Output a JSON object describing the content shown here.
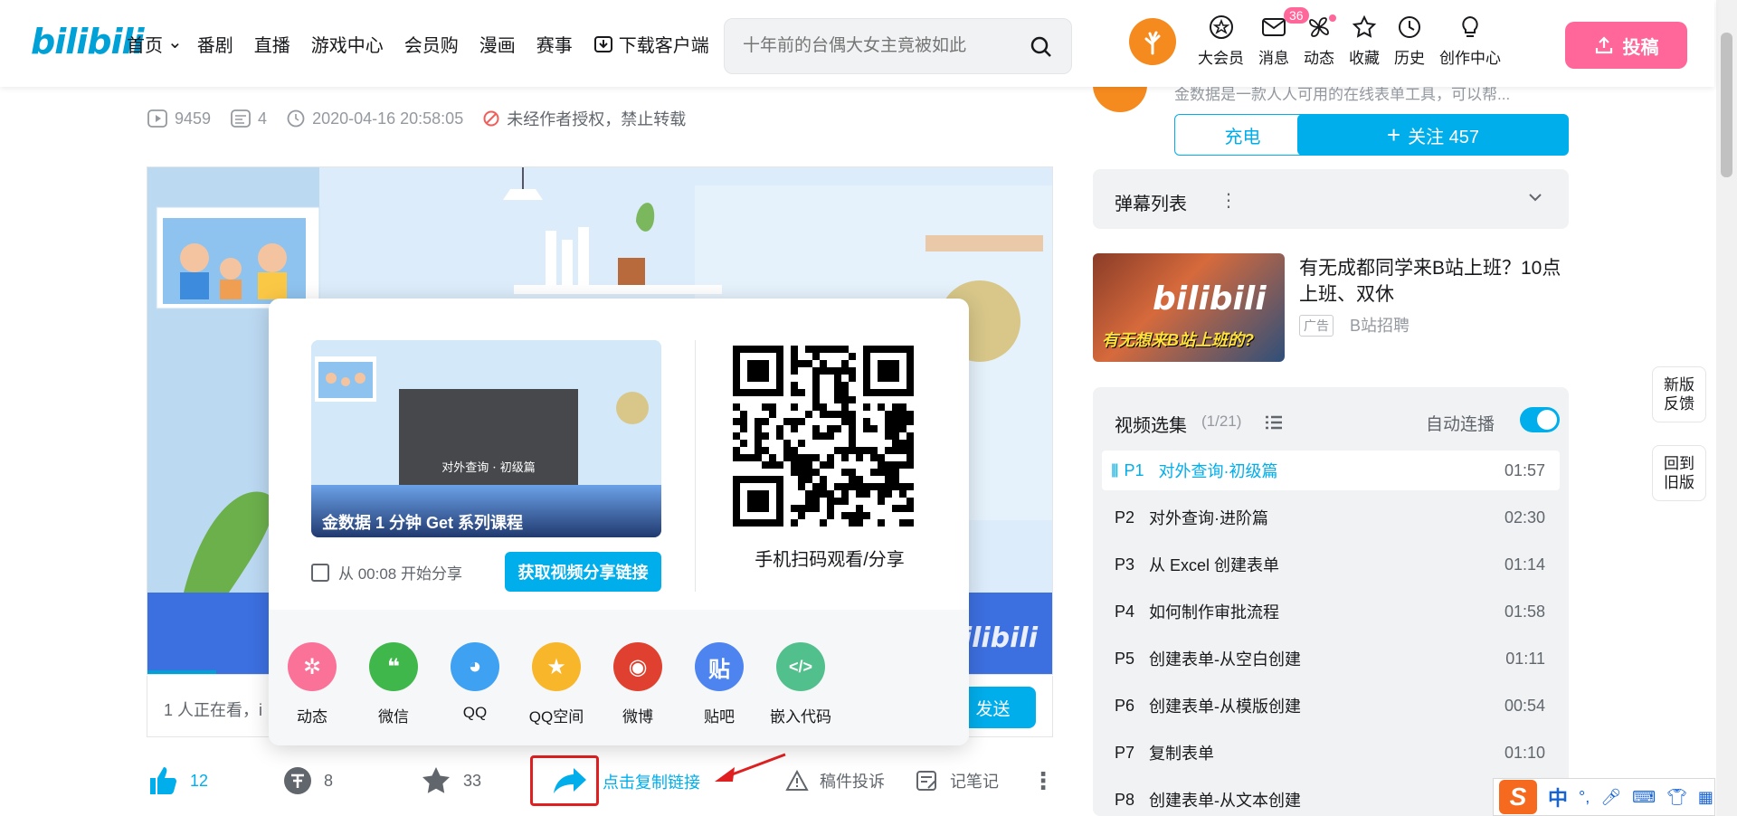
{
  "header": {
    "logo": "bilibili",
    "nav": [
      "首页",
      "番剧",
      "直播",
      "游戏中心",
      "会员购",
      "漫画",
      "赛事"
    ],
    "download": "下载客户端",
    "search_placeholder": "十年前的台偶大女主竟被如此",
    "icons": [
      {
        "label": "大会员",
        "icon": "vip-icon"
      },
      {
        "label": "消息",
        "icon": "message-icon",
        "badge": "36"
      },
      {
        "label": "动态",
        "icon": "dynamic-icon"
      },
      {
        "label": "收藏",
        "icon": "favorite-icon"
      },
      {
        "label": "历史",
        "icon": "history-icon"
      },
      {
        "label": "创作中心",
        "icon": "creator-icon"
      }
    ],
    "upload": "投稿"
  },
  "video_meta": {
    "views": "9459",
    "danmaku": "4",
    "date": "2020-04-16 20:58:05",
    "copyright": "未经作者授权，禁止转载"
  },
  "danmu_bar": {
    "watching": "1 人正在看，i",
    "send": "发送"
  },
  "actions": {
    "likes": "12",
    "coins": "8",
    "favorites": "33",
    "copy_link": "点击复制链接",
    "report": "稿件投诉",
    "notes": "记笔记"
  },
  "share_popup": {
    "video_caption": "金数据 1 分钟 Get 系列课程",
    "video_inner_title": "对外查询 · 初级篇",
    "start_share": "从 00:08 开始分享",
    "get_link": "获取视频分享链接",
    "qr_label": "手机扫码观看/分享",
    "targets": [
      {
        "label": "动态",
        "color": "#fb7299",
        "glyph": "✲"
      },
      {
        "label": "微信",
        "color": "#3fb74b",
        "glyph": "❝"
      },
      {
        "label": "QQ",
        "color": "#3ea1f2",
        "glyph": "◕"
      },
      {
        "label": "QQ空间",
        "color": "#f8b62b",
        "glyph": "★"
      },
      {
        "label": "微博",
        "color": "#e0402f",
        "glyph": "◉"
      },
      {
        "label": "贴吧",
        "color": "#4d84f0",
        "glyph": "贴"
      },
      {
        "label": "嵌入代码",
        "color": "#52c08c",
        "glyph": "</>"
      }
    ]
  },
  "uploader": {
    "desc": "金数据是一款人人可用的在线表单工具，可以帮...",
    "charge": "充电",
    "follow": "关注 457"
  },
  "danmaku_list": {
    "title": "弹幕列表"
  },
  "ad": {
    "title": "有无成都同学来B站上班？10点上班、双休",
    "tag": "广告",
    "source": "B站招聘",
    "image_logo": "bilibili",
    "image_slogan": "有无想来B站上班的?"
  },
  "playlist": {
    "title": "视频选集",
    "count": "(1/21)",
    "autoplay": "自动连播",
    "episodes": [
      {
        "p": "P1",
        "title": "对外查询·初级篇",
        "dur": "01:57",
        "active": true
      },
      {
        "p": "P2",
        "title": "对外查询·进阶篇",
        "dur": "02:30"
      },
      {
        "p": "P3",
        "title": "从 Excel 创建表单",
        "dur": "01:14"
      },
      {
        "p": "P4",
        "title": "如何制作审批流程",
        "dur": "01:58"
      },
      {
        "p": "P5",
        "title": "创建表单-从空白创建",
        "dur": "01:11"
      },
      {
        "p": "P6",
        "title": "创建表单-从模版创建",
        "dur": "00:54"
      },
      {
        "p": "P7",
        "title": "复制表单",
        "dur": "01:10"
      },
      {
        "p": "P8",
        "title": "创建表单-从文本创建",
        "dur": ""
      }
    ]
  },
  "side_buttons": {
    "feedback": "新版反馈",
    "back_old": "回到旧版"
  },
  "ime": {
    "logo": "S",
    "lang": "中"
  }
}
